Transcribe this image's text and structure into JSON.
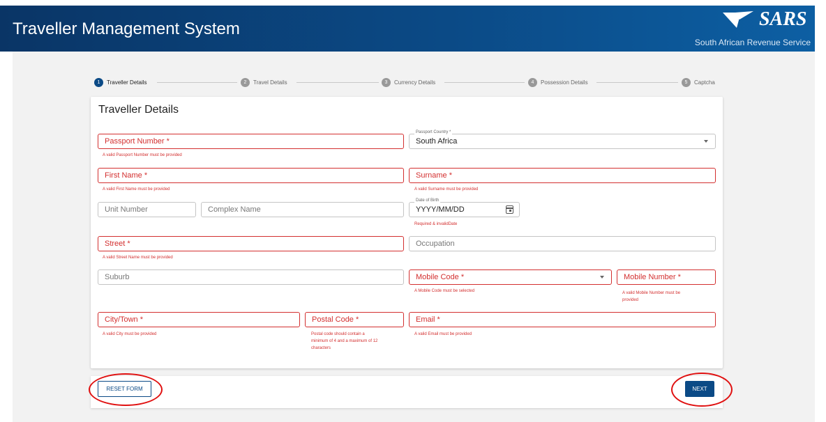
{
  "header": {
    "title": "Traveller Management System",
    "logo_text": "SARS",
    "logo_subtitle": "South African Revenue Service"
  },
  "stepper": [
    {
      "num": "1",
      "label": "Traveller Details"
    },
    {
      "num": "2",
      "label": "Travel Details"
    },
    {
      "num": "3",
      "label": "Currency Details"
    },
    {
      "num": "4",
      "label": "Possession Details"
    },
    {
      "num": "5",
      "label": "Captcha"
    }
  ],
  "form": {
    "title": "Traveller Details",
    "passport_number": {
      "placeholder": "Passport Number *",
      "error": "A valid Passport Number must be provided"
    },
    "passport_country": {
      "label": "Passport Country *",
      "value": "South Africa"
    },
    "first_name": {
      "placeholder": "First Name *",
      "error": "A valid First Name must be provided"
    },
    "surname": {
      "placeholder": "Surname *",
      "error": "A valid Surname must be provided"
    },
    "unit_number": {
      "placeholder": "Unit Number"
    },
    "complex_name": {
      "placeholder": "Complex Name"
    },
    "date_of_birth": {
      "label": "Date of Birth",
      "value": "YYYY/MM/DD",
      "error": "Required & invalidDate"
    },
    "street": {
      "placeholder": "Street *",
      "error": "A valid Street Name must be provided"
    },
    "occupation": {
      "placeholder": "Occupation"
    },
    "suburb": {
      "placeholder": "Suburb"
    },
    "mobile_code": {
      "placeholder": "Mobile Code *",
      "error": "A Mobile Code must be selected"
    },
    "mobile_number": {
      "placeholder": "Mobile Number *",
      "error_1": "A valid Mobile Number must be",
      "error_2": "provided"
    },
    "city": {
      "placeholder": "City/Town *",
      "error": "A valid City must be provided"
    },
    "postal_code": {
      "placeholder": "Postal Code *",
      "error_1": "Postal code should contain a",
      "error_2": "minimum of 4 and a maximum of 12",
      "error_3": "characters"
    },
    "email": {
      "placeholder": "Email *",
      "error": "A valid Email must be provided"
    }
  },
  "buttons": {
    "reset": "RESET FORM",
    "next": "NEXT"
  },
  "colors": {
    "brand": "#0b4a86",
    "error": "#d32f2f",
    "highlight_ring": "#e01010"
  }
}
